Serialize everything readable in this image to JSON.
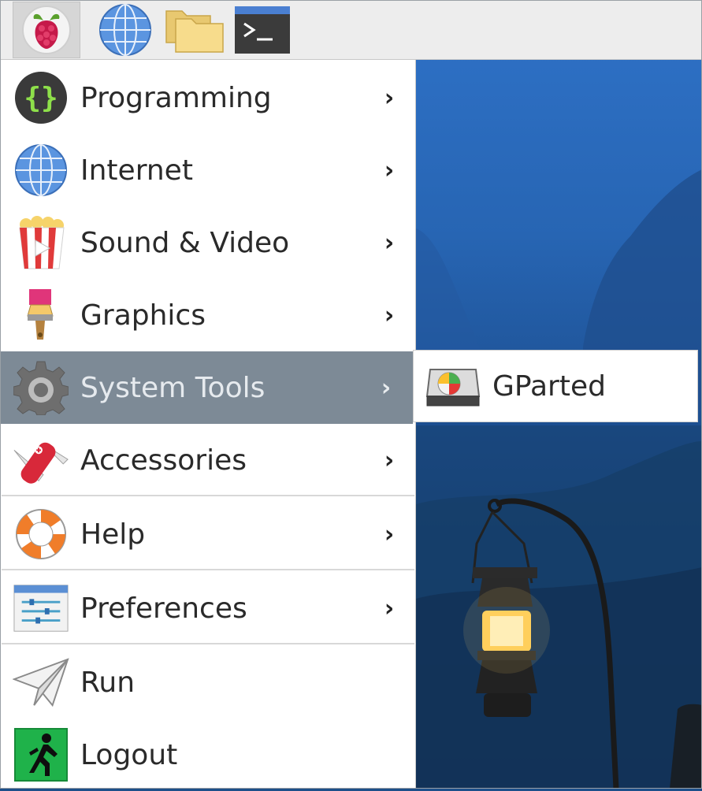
{
  "taskbar": {
    "buttons": [
      {
        "name": "raspberry-menu-button",
        "icon": "raspberry-icon"
      },
      {
        "name": "web-browser-button",
        "icon": "globe-icon"
      },
      {
        "name": "file-manager-button",
        "icon": "folder-icon"
      },
      {
        "name": "terminal-button",
        "icon": "terminal-icon"
      }
    ]
  },
  "menu": {
    "items": [
      {
        "label": "Programming",
        "icon": "braces-icon"
      },
      {
        "label": "Internet",
        "icon": "globe-icon"
      },
      {
        "label": "Sound & Video",
        "icon": "popcorn-video-icon"
      },
      {
        "label": "Graphics",
        "icon": "paintbrush-icon"
      },
      {
        "label": "System Tools",
        "icon": "gear-icon",
        "active": true
      },
      {
        "label": "Accessories",
        "icon": "pocketknife-icon"
      },
      {
        "label": "Help",
        "icon": "lifebuoy-icon"
      },
      {
        "label": "Preferences",
        "icon": "sliders-icon"
      },
      {
        "label": "Run",
        "icon": "paper-plane-icon"
      },
      {
        "label": "Logout",
        "icon": "exit-icon"
      }
    ],
    "arrow": "›"
  },
  "submenu": {
    "items": [
      {
        "label": "GParted",
        "icon": "disk-partition-icon"
      }
    ]
  },
  "colors": {
    "active_item_bg": "#7d8a96",
    "panel_bg": "#ededed",
    "menu_bg": "#ffffff"
  }
}
